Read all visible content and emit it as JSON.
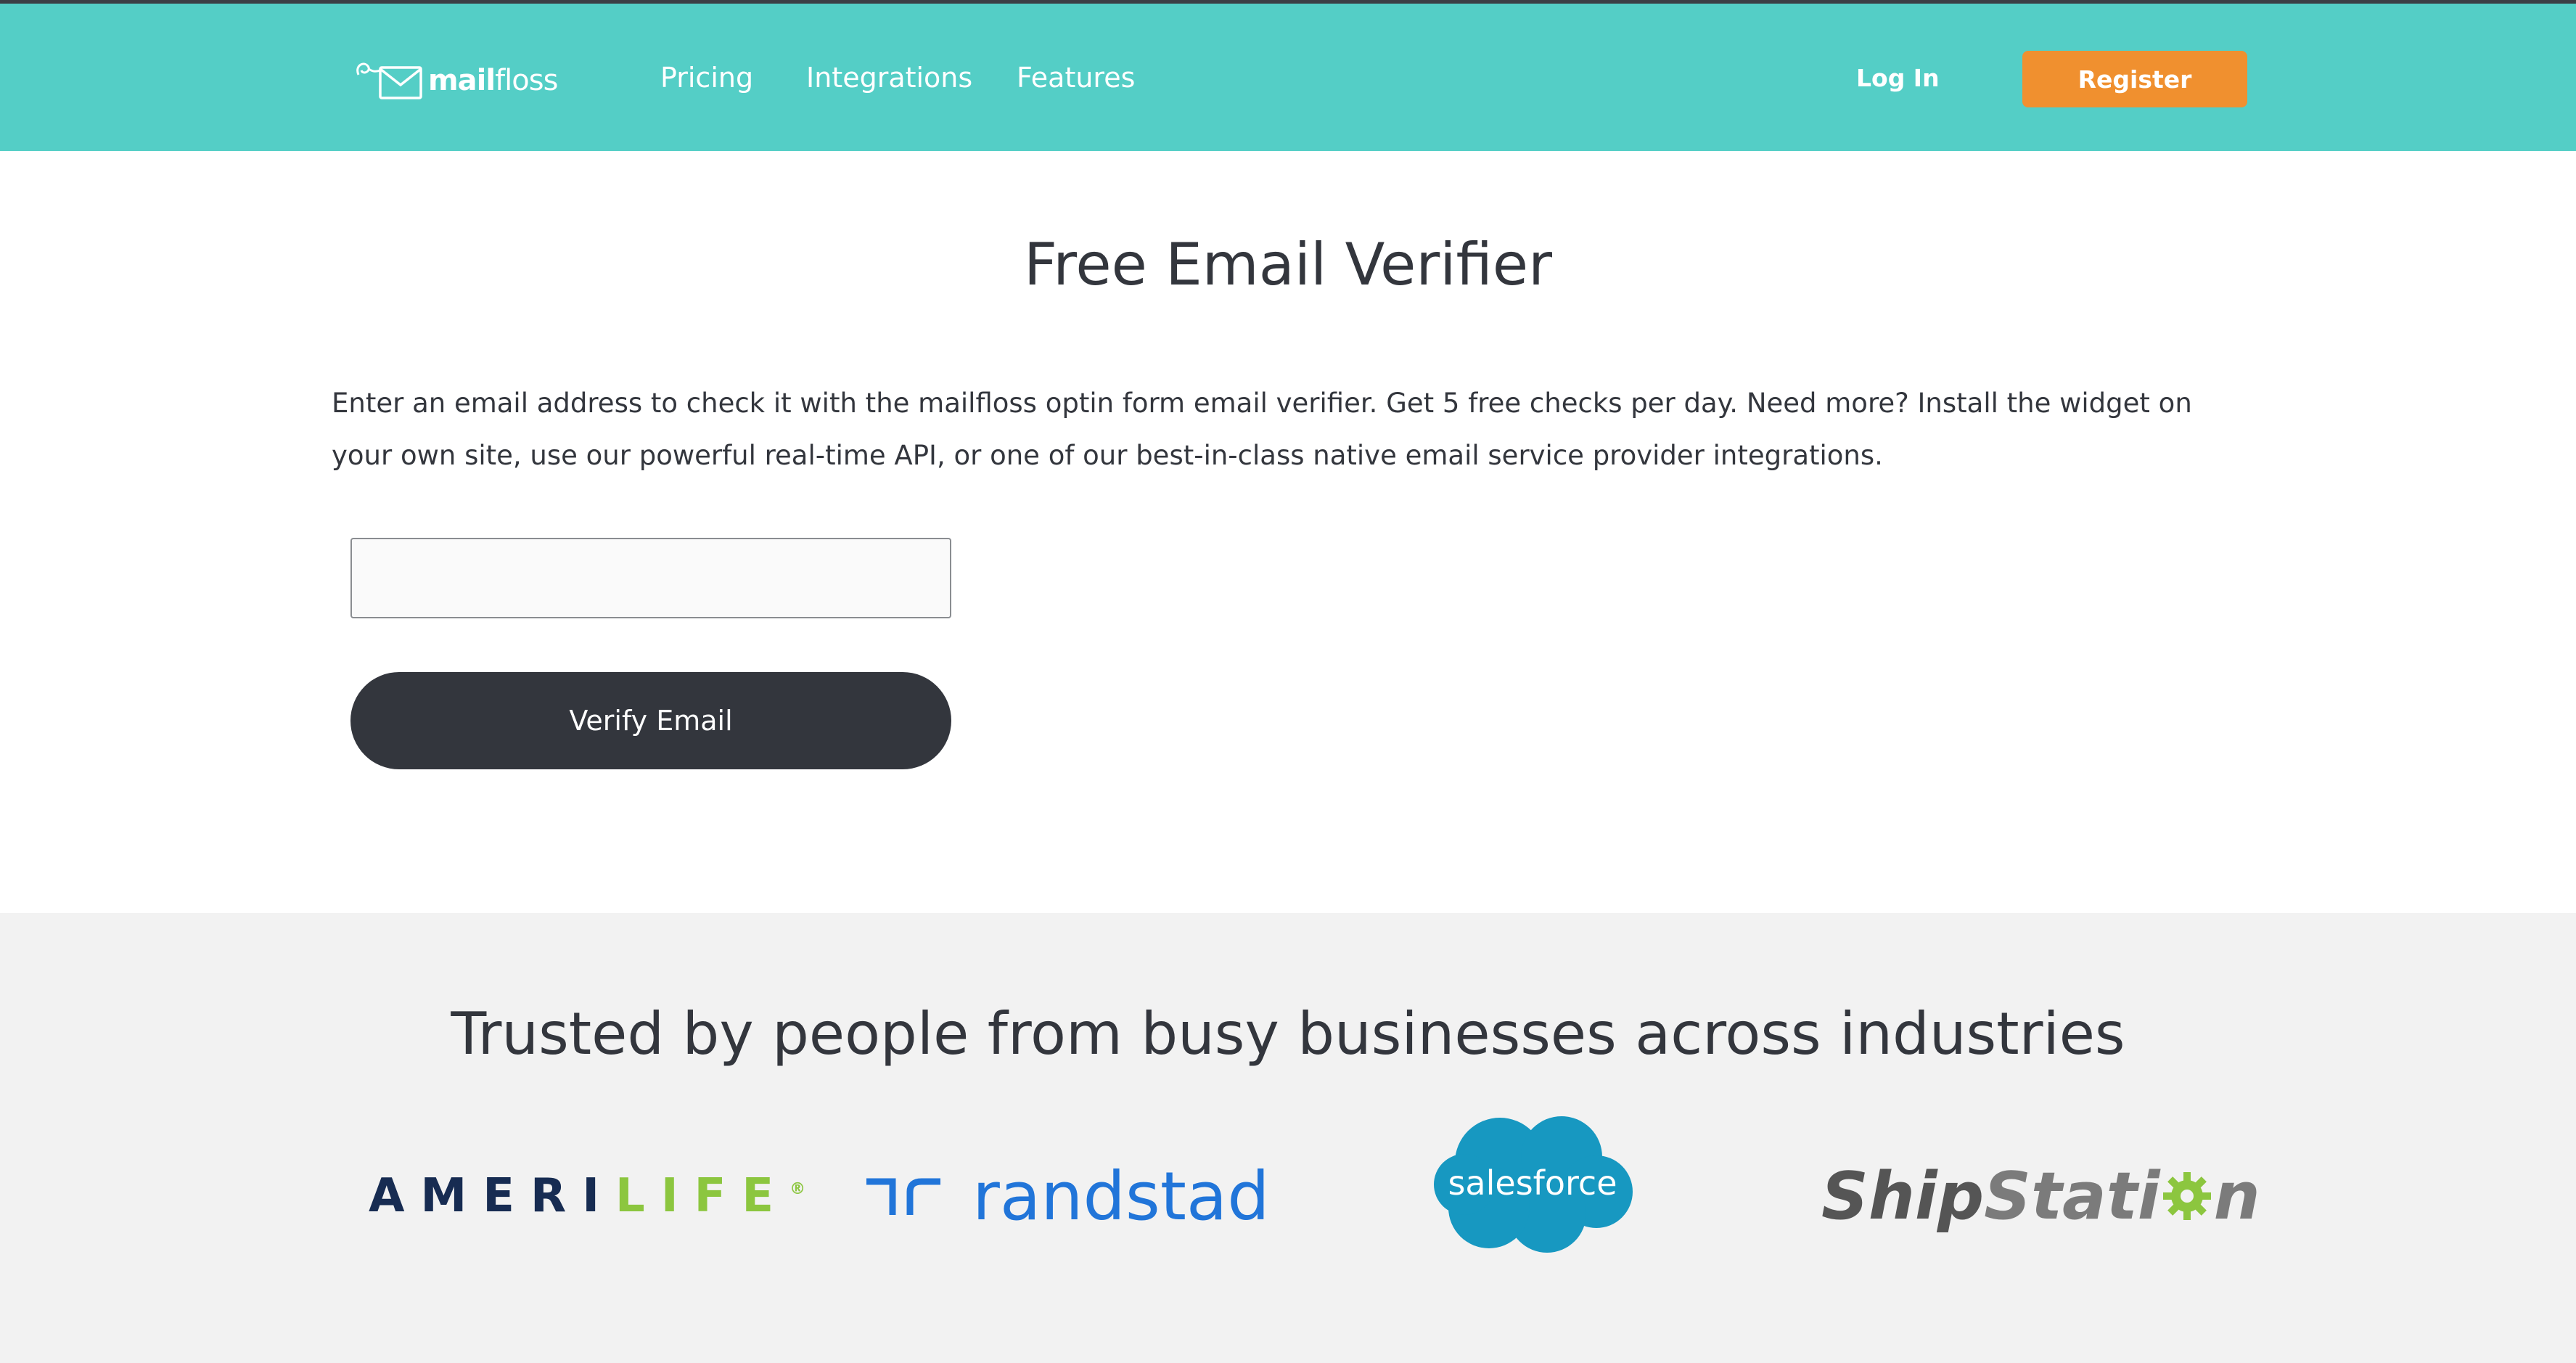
{
  "header": {
    "logo": {
      "bold": "mail",
      "light": "floss",
      "icon": "envelope-icon"
    },
    "nav": [
      {
        "label": "Pricing"
      },
      {
        "label": "Integrations"
      },
      {
        "label": "Features"
      }
    ],
    "login_label": "Log In",
    "register_label": "Register"
  },
  "main": {
    "title": "Free Email Verifier",
    "description": "Enter an email address to check it with the mailfloss optin form email verifier. Get 5 free checks per day. Need more? Install the widget on your own site, use our powerful real-time API, or one of our best-in-class native email service provider integrations.",
    "email_value": "",
    "email_placeholder": "",
    "verify_label": "Verify Email"
  },
  "trusted": {
    "title": "Trusted by people from busy businesses across industries",
    "logos": [
      {
        "part1": "AMERI",
        "part2": "LIFE",
        "mark": "®"
      },
      {
        "text": "randstad",
        "icon": "randstad-mark-icon"
      },
      {
        "text": "salesforce",
        "icon": "cloud-icon"
      },
      {
        "part1": "Ship",
        "part2": "Stati",
        "part3": "n",
        "icon": "gear-icon"
      }
    ]
  },
  "colors": {
    "header_bg": "#54cec6",
    "register_bg": "#f0902f",
    "button_dark": "#33363d",
    "trusted_bg": "#f2f2f2"
  }
}
